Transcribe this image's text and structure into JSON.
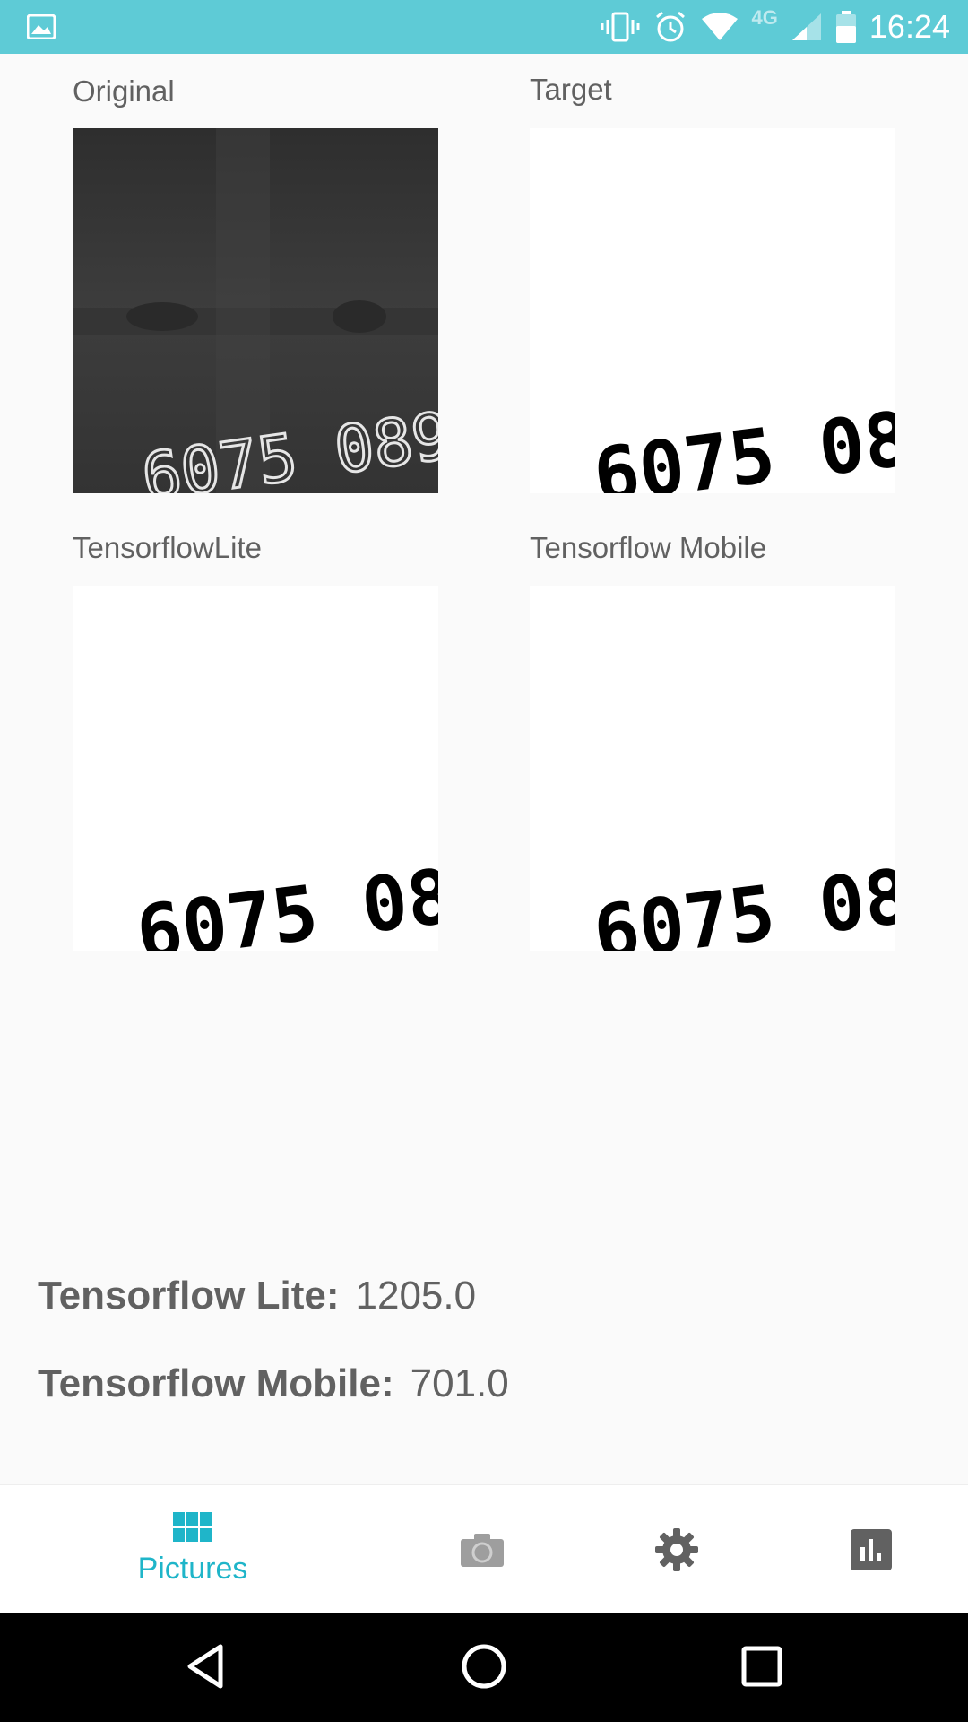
{
  "status_bar": {
    "time": "16:24",
    "network": "4G",
    "icons": [
      "gallery-notification-icon",
      "vibrate-icon",
      "alarm-icon",
      "wifi-icon",
      "cellular-signal-icon",
      "battery-icon"
    ],
    "background": "#5ecbd6"
  },
  "tiles": [
    {
      "label": "Original",
      "kind": "dark"
    },
    {
      "label": "Target",
      "kind": "light"
    },
    {
      "label": "TensorflowLite",
      "kind": "light"
    },
    {
      "label": "Tensorflow Mobile",
      "kind": "light"
    }
  ],
  "tile_image_text": "6075 089",
  "results": [
    {
      "key": "Tensorflow Lite:",
      "value": "1205.0"
    },
    {
      "key": "Tensorflow Mobile:",
      "value": "701.0"
    }
  ],
  "bottom_nav": {
    "items": [
      {
        "name": "pictures",
        "label": "Pictures",
        "icon": "grid-icon",
        "active": true
      },
      {
        "name": "camera",
        "label": "",
        "icon": "camera-icon",
        "active": false
      },
      {
        "name": "settings",
        "label": "",
        "icon": "gear-icon",
        "active": false
      },
      {
        "name": "stats",
        "label": "",
        "icon": "bar-chart-icon",
        "active": false
      }
    ],
    "accent": "#1fb5c9",
    "inactive": "#616161"
  },
  "system_nav": [
    "back-icon",
    "home-icon",
    "recents-icon"
  ]
}
